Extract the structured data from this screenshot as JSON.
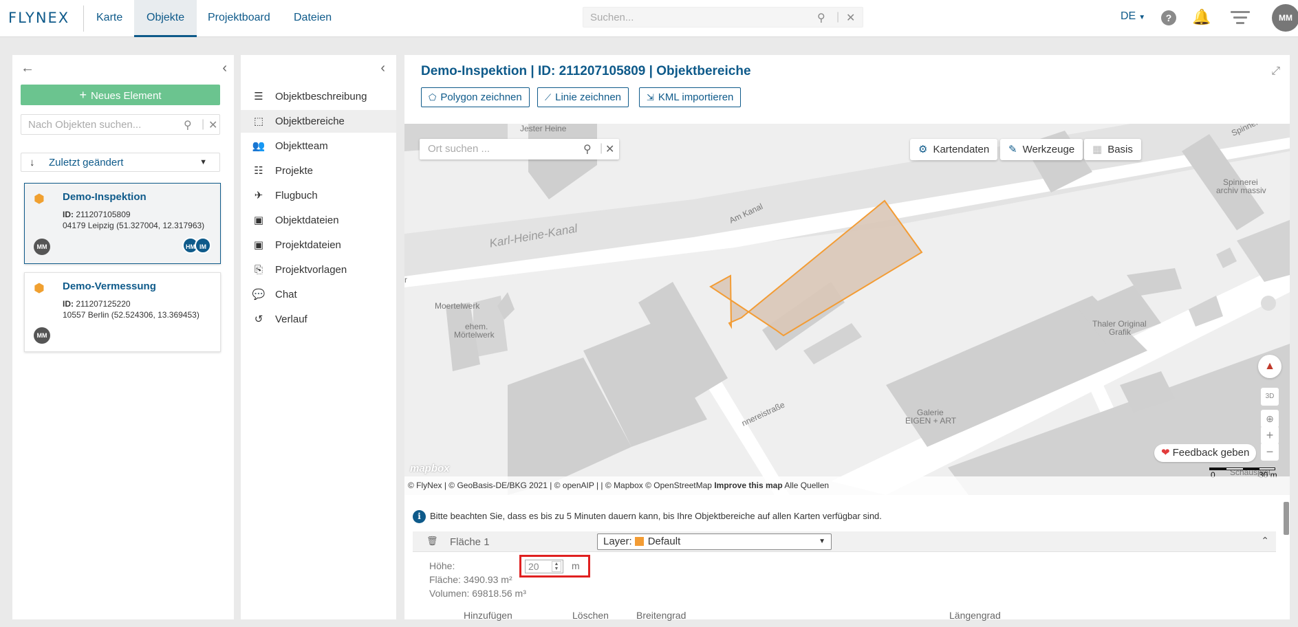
{
  "brand": {
    "logo_text": "FLYNEX",
    "accent": "#0e5a8a"
  },
  "nav": {
    "items": [
      {
        "label": "Karte",
        "active": false
      },
      {
        "label": "Objekte",
        "active": true
      },
      {
        "label": "Projektboard",
        "active": false
      },
      {
        "label": "Dateien",
        "active": false
      }
    ]
  },
  "top_search": {
    "placeholder": "Suchen..."
  },
  "topbar_right": {
    "language": "DE",
    "help_glyph": "?",
    "user_initials": "MM"
  },
  "left": {
    "new_button": "Neues Element",
    "search_placeholder": "Nach Objekten suchen...",
    "sort_label": "Zuletzt geändert",
    "objects": [
      {
        "title": "Demo-Inspektion",
        "id_label": "ID:",
        "id": "211207105809",
        "address": "04179 Leipzig (51.327004, 12.317963)",
        "owner": "MM",
        "members": [
          "HM",
          "IM"
        ],
        "selected": true
      },
      {
        "title": "Demo-Vermessung",
        "id_label": "ID:",
        "id": "211207125220",
        "address": "10557 Berlin (52.524306, 13.369453)",
        "owner": "MM",
        "members": [],
        "selected": false
      }
    ]
  },
  "menu": {
    "items": [
      {
        "label": "Objektbeschreibung",
        "icon": "list-icon",
        "glyph": "☰",
        "active": false
      },
      {
        "label": "Objektbereiche",
        "icon": "area-select-icon",
        "glyph": "⬚",
        "active": true
      },
      {
        "label": "Objektteam",
        "icon": "users-icon",
        "glyph": "👥",
        "active": false
      },
      {
        "label": "Projekte",
        "icon": "sitemap-icon",
        "glyph": "☷",
        "active": false
      },
      {
        "label": "Flugbuch",
        "icon": "plane-icon",
        "glyph": "✈",
        "active": false
      },
      {
        "label": "Objektdateien",
        "icon": "folder-image-icon",
        "glyph": "▣",
        "active": false
      },
      {
        "label": "Projektdateien",
        "icon": "folder-image-icon",
        "glyph": "▣",
        "active": false
      },
      {
        "label": "Projektvorlagen",
        "icon": "template-icon",
        "glyph": "⎘",
        "active": false
      },
      {
        "label": "Chat",
        "icon": "chat-icon",
        "glyph": "💬",
        "active": false
      },
      {
        "label": "Verlauf",
        "icon": "history-icon",
        "glyph": "↺",
        "active": false
      }
    ]
  },
  "main": {
    "title": "Demo-Inspektion | ID: 211207105809 | Objektbereiche",
    "tools": [
      {
        "label": "Polygon zeichnen",
        "icon": "pentagon-icon",
        "glyph": "⬠"
      },
      {
        "label": "Linie zeichnen",
        "icon": "polyline-icon",
        "glyph": "⟋"
      },
      {
        "label": "KML importieren",
        "icon": "file-import-icon",
        "glyph": "⇲"
      }
    ]
  },
  "map": {
    "search_placeholder": "Ort suchen ...",
    "buttons": {
      "kartendaten": "Kartendaten",
      "werkzeuge": "Werkzeuge",
      "basis": "Basis"
    },
    "labels": {
      "jester": "Jester Heine",
      "kanal": "Karl-Heine-Kanal",
      "am_kanal": "Am Kanal",
      "moertelwerk": "Moertelwerk",
      "ehem": "ehem.",
      "mortelwerk": "Mörtelwerk",
      "spinnerei": "Spinnerei",
      "archiv": "archiv massiv",
      "thaler1": "Thaler Original",
      "thaler2": "Grafik",
      "strasse": "nnereistraße",
      "galerie1": "Galerie",
      "galerie2": "EIGEN + ART",
      "schauspiel": "Schauspiel",
      "spinnerei_top": "Spinnerei",
      "edge_r": "r"
    },
    "ctrl_3d": "3D",
    "feedback": "Feedback geben",
    "scale": {
      "zero": "0",
      "end": "30 m"
    },
    "mapbox_logo": "mapbox",
    "attribution": "© FlyNex | © GeoBasis-DE/BKG 2021 | © openAIP | | © Mapbox © OpenStreetMap",
    "improve": "Improve this map",
    "sources": "Alle Quellen",
    "polygon_fill": "#d9c7b7",
    "polygon_stroke": "#f39c34"
  },
  "bottom": {
    "info": "Bitte beachten Sie, dass es bis zu 5 Minuten dauern kann, bis Ihre Objektbereiche auf allen Karten verfügbar sind.",
    "area_name": "Fläche 1",
    "layer_label": "Layer:",
    "layer_value": "Default",
    "layer_color": "#f39c34",
    "height_label": "Höhe:",
    "height_value": "20",
    "height_unit": "m",
    "area_label": "Fläche: 3490.93 m²",
    "volume_label": "Volumen: 69818.56 m³",
    "columns": [
      "Hinzufügen",
      "Löschen",
      "Breitengrad",
      "Längengrad"
    ]
  }
}
